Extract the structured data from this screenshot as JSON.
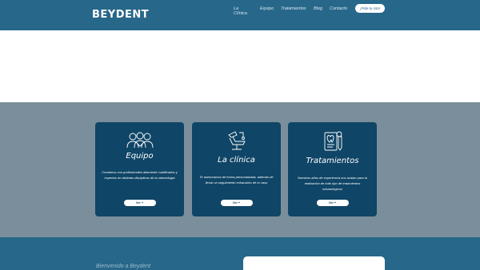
{
  "header": {
    "logo": "BEYDENT",
    "nav": [
      "La Clínica",
      "Equipo",
      "Tratamientos",
      "Blog",
      "Contacto"
    ],
    "cta": "¡Pide tu cita!"
  },
  "cards": [
    {
      "icon": "team-icon",
      "title": "Equipo",
      "desc": "Contamos con profesionales altamente cualificados y expertos en distintas disciplinas de la odontología",
      "button": "Ver +"
    },
    {
      "icon": "dental-chair-icon",
      "title": "La clínica",
      "desc": "Te asesoramos de forma personalizada, además de llevar un seguimiento exhaustivo de tu caso",
      "button": "Ver +"
    },
    {
      "icon": "treatment-document-icon",
      "title": "Tratamientos",
      "desc": "Nuestros años de experiencia nos avalan para la realización de todo tipo de tratamientos odontológicos",
      "button": "Ver +"
    }
  ],
  "footer": {
    "welcome": "Bienvenido a Beydent"
  },
  "colors": {
    "header": "#27678a",
    "card": "#0f4566",
    "band": "#7a8f9b"
  }
}
